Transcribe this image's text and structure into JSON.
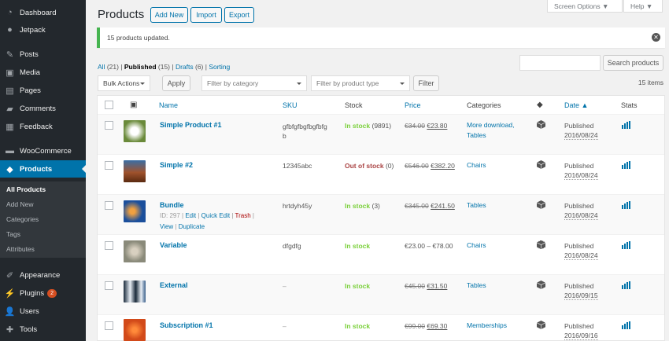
{
  "sidebar": {
    "items": [
      {
        "label": "Dashboard",
        "icon": "dashboard-icon"
      },
      {
        "label": "Jetpack",
        "icon": "jetpack-icon"
      },
      {
        "label": "Posts",
        "icon": "posts-icon"
      },
      {
        "label": "Media",
        "icon": "media-icon"
      },
      {
        "label": "Pages",
        "icon": "pages-icon"
      },
      {
        "label": "Comments",
        "icon": "comments-icon"
      },
      {
        "label": "Feedback",
        "icon": "feedback-icon"
      },
      {
        "label": "WooCommerce",
        "icon": "woocommerce-icon"
      },
      {
        "label": "Products",
        "icon": "products-icon"
      },
      {
        "label": "Appearance",
        "icon": "appearance-icon"
      },
      {
        "label": "Plugins",
        "icon": "plugins-icon",
        "badge": "2"
      },
      {
        "label": "Users",
        "icon": "users-icon"
      },
      {
        "label": "Tools",
        "icon": "tools-icon"
      }
    ],
    "submenu": [
      "All Products",
      "Add New",
      "Categories",
      "Tags",
      "Attributes"
    ]
  },
  "header": {
    "title": "Products",
    "add_new": "Add New",
    "import": "Import",
    "export": "Export",
    "screen_options": "Screen Options ▼",
    "help": "Help ▼"
  },
  "notice": "15 products updated.",
  "filters": {
    "all": "All",
    "all_count": "(21)",
    "published": "Published",
    "published_count": "(15)",
    "drafts": "Drafts",
    "drafts_count": "(6)",
    "sorting": "Sorting",
    "search_button": "Search products",
    "bulk_actions": "Bulk Actions",
    "apply": "Apply",
    "category_placeholder": "Filter by category",
    "type_placeholder": "Filter by product type",
    "filter": "Filter",
    "items_count": "15 items"
  },
  "columns": {
    "name": "Name",
    "sku": "SKU",
    "stock": "Stock",
    "price": "Price",
    "categories": "Categories",
    "date": "Date ▲",
    "stats": "Stats"
  },
  "rows": [
    {
      "name": "Simple Product #1",
      "sku": "gfbfgfbgfbgfbfg",
      "sku2": "b",
      "stock": "In stock",
      "stock_count": "(9891)",
      "old_price": "€34.00",
      "new_price": "€23.80",
      "cat": "More download,",
      "cat2": "Tables",
      "status": "Published",
      "date": "2016/08/24",
      "thumb": "#6a8a3a"
    },
    {
      "name": "Simple #2",
      "sku": "12345abc",
      "stock": "Out of stock",
      "stock_count": "(0)",
      "old_price": "€546.00",
      "new_price": "€382.20",
      "cat": "Chairs",
      "cat2": "",
      "status": "Published",
      "date": "2016/08/24",
      "thumb": "#a0522d"
    },
    {
      "name": "Bundle",
      "sku": "hrtdyh45y",
      "stock": "In stock",
      "stock_count": "(3)",
      "old_price": "€345.00",
      "new_price": "€241.50",
      "cat": "Tables",
      "cat2": "",
      "status": "Published",
      "date": "2016/08/24",
      "thumb": "#1b4f9c",
      "id": "ID: 297",
      "edit": "Edit",
      "quick_edit": "Quick Edit",
      "trash": "Trash",
      "view": "View",
      "duplicate": "Duplicate"
    },
    {
      "name": "Variable",
      "sku": "dfgdfg",
      "stock": "In stock",
      "stock_count": "",
      "price_range": "€23.00 – €78.00",
      "cat": "Chairs",
      "cat2": "",
      "status": "Published",
      "date": "2016/08/24",
      "thumb": "#8a8a7a"
    },
    {
      "name": "External",
      "sku": "–",
      "stock": "In stock",
      "stock_count": "",
      "old_price": "€45.00",
      "new_price": "€31.50",
      "cat": "Tables",
      "cat2": "",
      "status": "Published",
      "date": "2016/09/15",
      "thumb": "#3a5f8a"
    },
    {
      "name": "Subscription #1",
      "sku": "–",
      "stock": "In stock",
      "stock_count": "",
      "old_price": "€99.00",
      "new_price": "€69.30",
      "cat": "Memberships",
      "cat2": "",
      "status": "Published",
      "date": "2016/09/16",
      "thumb": "#d24a1a"
    }
  ]
}
